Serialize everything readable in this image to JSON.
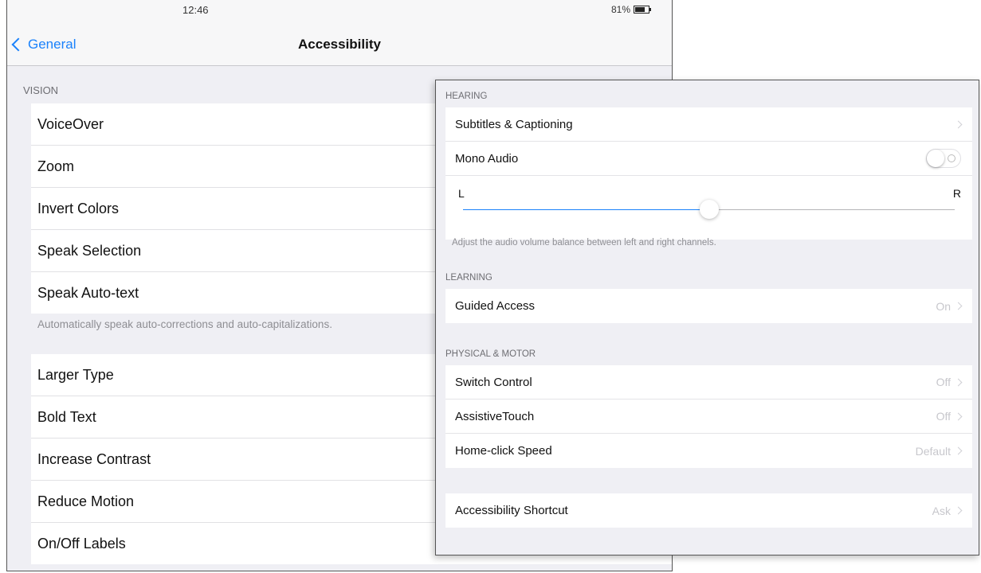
{
  "status_bar": {
    "time": "12:46",
    "battery": "81%"
  },
  "nav": {
    "back_label": "General",
    "title": "Accessibility"
  },
  "left": {
    "vision_header": "VISION",
    "vision_items": [
      "VoiceOver",
      "Zoom",
      "Invert Colors",
      "Speak Selection",
      "Speak Auto-text"
    ],
    "vision_footer": "Automatically speak auto-corrections and auto-capitalizations.",
    "text_items": [
      "Larger Type",
      "Bold Text",
      "Increase Contrast",
      "Reduce Motion",
      "On/Off Labels"
    ]
  },
  "right": {
    "hearing_header": "HEARING",
    "subtitles_label": "Subtitles & Captioning",
    "mono_audio_label": "Mono Audio",
    "mono_audio_on": false,
    "balance": {
      "left_label": "L",
      "right_label": "R",
      "value": 0.5
    },
    "balance_footer": "Adjust the audio volume balance between left and right channels.",
    "learning_header": "LEARNING",
    "guided_access": {
      "label": "Guided Access",
      "value": "On"
    },
    "physical_header": "PHYSICAL & MOTOR",
    "switch_control": {
      "label": "Switch Control",
      "value": "Off"
    },
    "assistive_touch": {
      "label": "AssistiveTouch",
      "value": "Off"
    },
    "home_click": {
      "label": "Home-click Speed",
      "value": "Default"
    },
    "shortcut": {
      "label": "Accessibility Shortcut",
      "value": "Ask"
    }
  },
  "colors": {
    "accent": "#1a82fb",
    "background": "#efeff4"
  }
}
